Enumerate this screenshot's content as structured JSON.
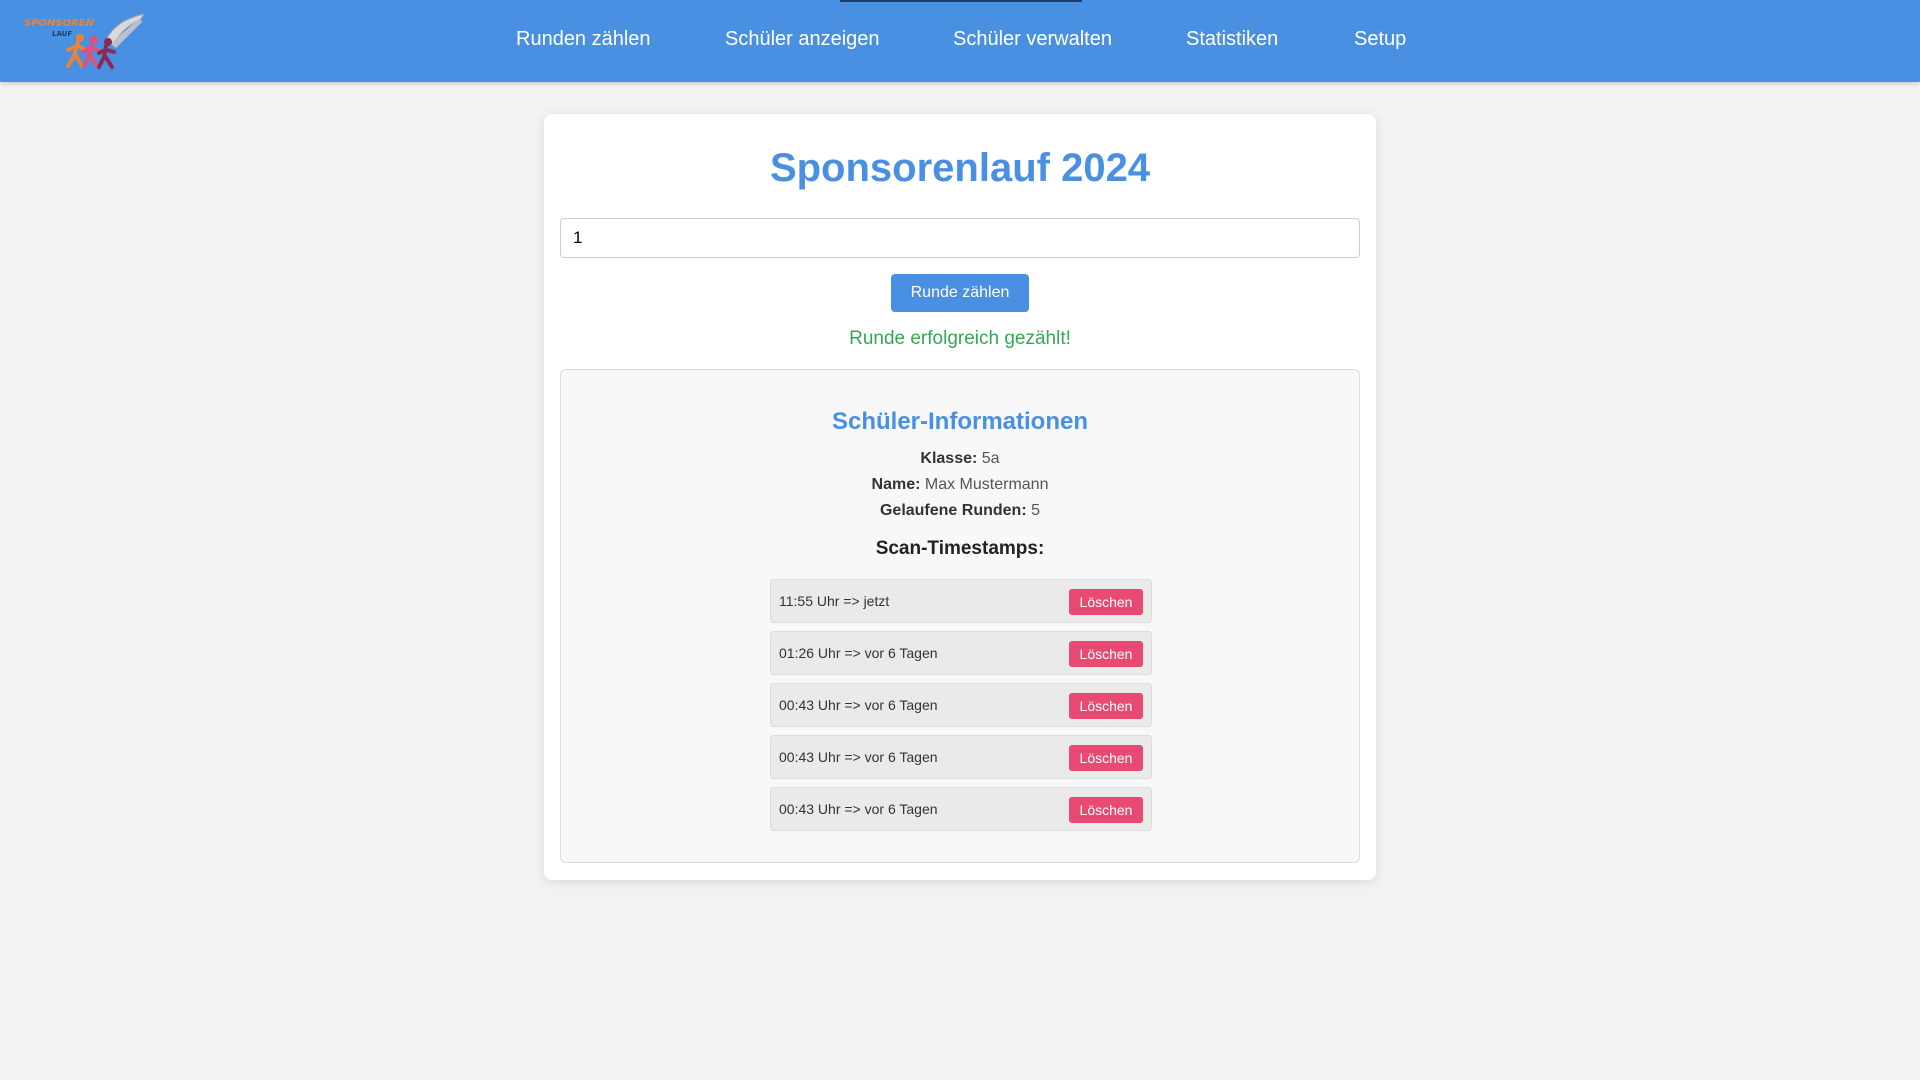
{
  "app": {
    "logo": {
      "text_top": "SPONSOREN",
      "text_bottom": "LAUF",
      "icon": "running-people-logo"
    }
  },
  "nav": {
    "items": [
      {
        "label": "Runden zählen"
      },
      {
        "label": "Schüler anzeigen"
      },
      {
        "label": "Schüler verwalten"
      },
      {
        "label": "Statistiken"
      },
      {
        "label": "Setup"
      }
    ]
  },
  "main": {
    "title": "Sponsorenlauf 2024",
    "input": {
      "value": "1",
      "placeholder": ""
    },
    "count_button_label": "Runde zählen",
    "status_message": "Runde erfolgreich gezählt!"
  },
  "student": {
    "title": "Schüler-Informationen",
    "fields": [
      {
        "label": "Klasse:",
        "value": "5a"
      },
      {
        "label": "Name:",
        "value": "Max Mustermann"
      },
      {
        "label": "Gelaufene Runden:",
        "value": "5"
      }
    ],
    "timestamps_title": "Scan-Timestamps:",
    "delete_label": "Löschen",
    "timestamps": [
      {
        "text": "11:55 Uhr => jetzt"
      },
      {
        "text": "01:26 Uhr => vor 6 Tagen"
      },
      {
        "text": "00:43 Uhr => vor 6 Tagen"
      },
      {
        "text": "00:43 Uhr => vor 6 Tagen"
      },
      {
        "text": "00:43 Uhr => vor 6 Tagen"
      }
    ]
  },
  "colors": {
    "primary": "#4a90e2",
    "success": "#34a853",
    "danger": "#e84a73",
    "background": "#f2f2f2"
  }
}
